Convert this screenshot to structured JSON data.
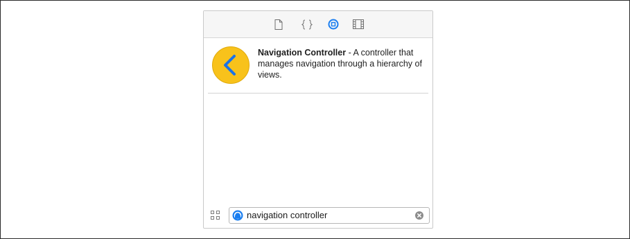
{
  "toolbar": {
    "tabs": [
      {
        "icon": "file-icon",
        "selected": false
      },
      {
        "icon": "braces-icon",
        "selected": false
      },
      {
        "icon": "object-library-icon",
        "selected": true
      },
      {
        "icon": "media-library-icon",
        "selected": false
      }
    ]
  },
  "library": {
    "items": [
      {
        "icon": "navigation-controller-icon",
        "title": "Navigation Controller",
        "description": " - A controller that manages navigation through a hierarchy of views."
      }
    ]
  },
  "filter": {
    "value": "navigation controller",
    "filter_icon": "object-filter-icon",
    "clear_icon": "clear-icon"
  },
  "colors": {
    "accent": "#1a7ef0",
    "icon_fill": "#f8c21b",
    "chevron": "#1a73e8"
  }
}
